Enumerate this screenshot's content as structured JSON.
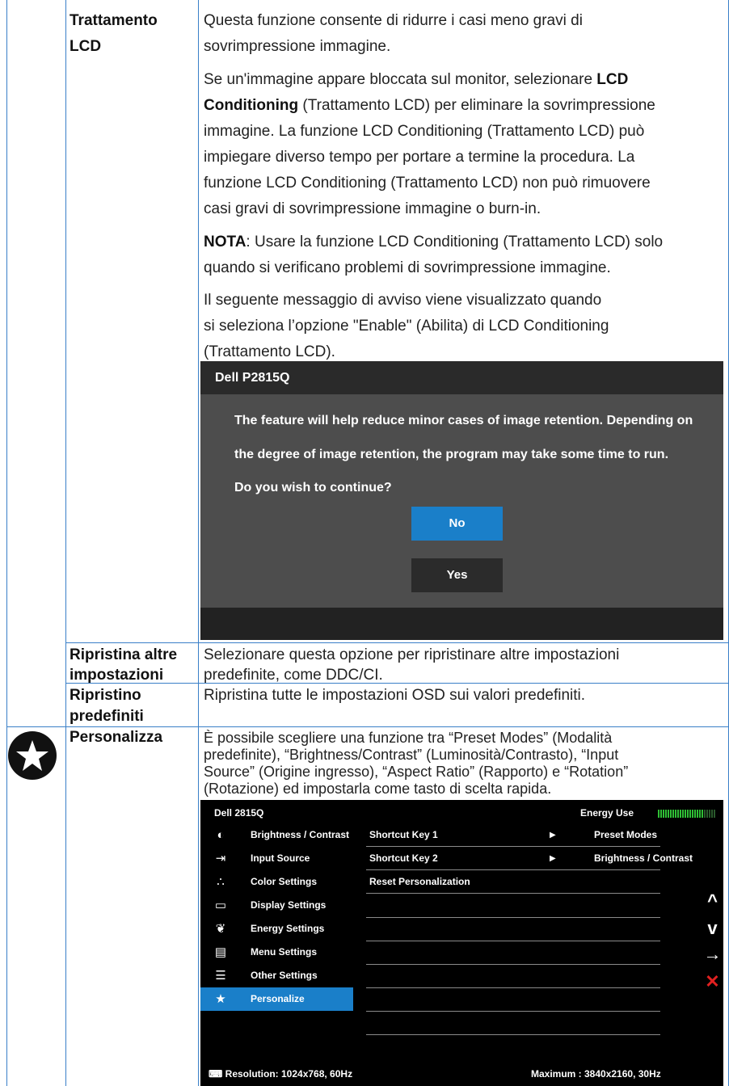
{
  "rows": {
    "lcd": {
      "label_line1": "Trattamento",
      "label_line2": "LCD",
      "p1_line1": "Questa funzione consente di ridurre i casi meno gravi di",
      "p1_line2": "sovrimpressione immagine.",
      "p2_line1_a": "Se un'immagine appare bloccata sul monitor, selezionare ",
      "p2_line1_b": "LCD",
      "p2_line2_a": "Conditioning",
      "p2_line2_b": " (Trattamento LCD) per eliminare la sovrimpressione",
      "p2_line3": "immagine. La funzione LCD Conditioning (Trattamento LCD) può",
      "p2_line4": "impiegare diverso tempo per portare a termine la procedura. La",
      "p2_line5": "funzione LCD Conditioning (Trattamento LCD) non può rimuovere",
      "p2_line6": "casi gravi di sovrimpressione immagine o burn-in.",
      "note_label": "NOTA",
      "note_line1": ": Usare la funzione LCD Conditioning (Trattamento LCD) solo",
      "note_line2": "quando si verificano problemi di sovrimpressione immagine.",
      "p4_line1": "Il seguente messaggio di avviso viene visualizzato quando",
      "p4_line2": "si seleziona l’opzione \"Enable\" (Abilita) di LCD Conditioning",
      "p4_line3": "(Trattamento LCD)."
    },
    "other": {
      "label_line1": "Ripristina altre",
      "label_line2": "impostazioni",
      "line1": "Selezionare questa opzione per ripristinare altre impostazioni",
      "line2": "predefinite, come DDC/CI."
    },
    "factory": {
      "label_line1": "Ripristino",
      "label_line2": "predefiniti",
      "line1": "Ripristina tutte le impostazioni OSD sui valori predefiniti."
    },
    "personalize": {
      "label": "Personalizza",
      "line1": "È possibile scegliere una funzione tra “Preset Modes” (Modalità",
      "line2": "predefinite), “Brightness/Contrast” (Luminosità/Contrasto), “Input",
      "line3": "Source” (Origine ingresso), “Aspect Ratio” (Rapporto) e “Rotation”",
      "line4": "(Rotazione) ed impostarla come tasto di scelta rapida."
    }
  },
  "dialog": {
    "title": "Dell P2815Q",
    "msg1": "The feature will help reduce minor cases of image retention. Depending on",
    "msg2": "the degree of image retention, the program may take some time to run.",
    "msg3": "Do you wish to continue?",
    "no_label": "No",
    "yes_label": "Yes",
    "no_color": "#1a7fc9",
    "yes_color": "#2b2b2b"
  },
  "osd": {
    "title": "Dell 2815Q",
    "energy_label": "Energy Use",
    "energy_level": 0.8,
    "menu": [
      {
        "label": "Brightness / Contrast",
        "icon": "brightness-icon"
      },
      {
        "label": "Input Source",
        "icon": "input-source-icon"
      },
      {
        "label": "Color Settings",
        "icon": "color-settings-icon"
      },
      {
        "label": "Display Settings",
        "icon": "display-settings-icon"
      },
      {
        "label": "Energy Settings",
        "icon": "energy-settings-icon"
      },
      {
        "label": "Menu Settings",
        "icon": "menu-settings-icon"
      },
      {
        "label": "Other Settings",
        "icon": "other-settings-icon"
      },
      {
        "label": "Personalize",
        "icon": "star-icon",
        "selected": true
      }
    ],
    "shortcut1_label": "Shortcut Key 1",
    "shortcut1_value": "Preset Modes",
    "shortcut2_label": "Shortcut Key 2",
    "shortcut2_value": "Brightness / Contrast",
    "reset_label": "Reset Personalization",
    "resolution": "Resolution: 1024x768,  60Hz",
    "maximum": "Maximum : 3840x2160,  30Hz",
    "nav_icons": [
      "up-arrow-icon",
      "down-arrow-icon",
      "enter-arrow-icon",
      "exit-x-icon"
    ]
  }
}
